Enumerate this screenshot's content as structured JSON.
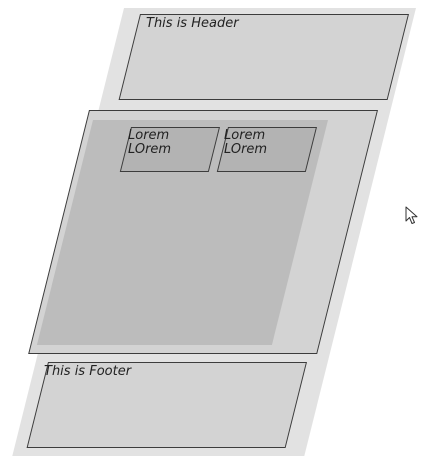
{
  "header": {
    "label": "This is Header"
  },
  "content": {
    "cards": [
      {
        "line1": "Lorem",
        "line2": "LOrem"
      },
      {
        "line1": "Lorem",
        "line2": "LOrem"
      }
    ]
  },
  "footer": {
    "label": "This is Footer"
  },
  "colors": {
    "frame": "#e2e2e2",
    "panel": "#d3d3d3",
    "inner_area": "#bcbcbc",
    "card": "#b3b3b3",
    "border": "#3c3c3c"
  },
  "icons": {
    "pointer": "mouse-pointer-icon"
  }
}
